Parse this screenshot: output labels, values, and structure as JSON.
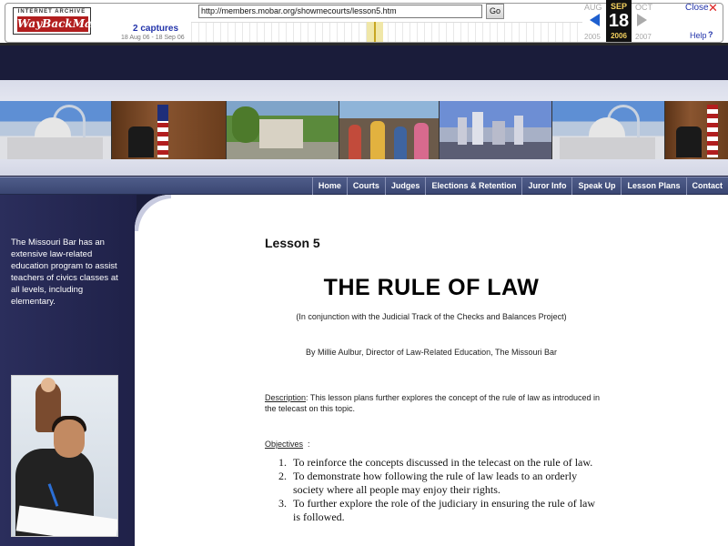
{
  "wayback": {
    "logo_top": "INTERNET ARCHIVE",
    "logo_main": "WayBackMachine",
    "url": "http://members.mobar.org/showmecourts/lesson5.htm",
    "go_label": "Go",
    "captures": "2 captures",
    "capture_range": "18 Aug 06 - 18 Sep 06",
    "month_prev": "AUG",
    "month_current": "SEP",
    "month_next": "OCT",
    "day": "18",
    "year_prev": "2005",
    "year_current": "2006",
    "year_next": "2007",
    "close_label": "Close",
    "help_label": "Help",
    "colors": {
      "accent": "#1e5fcf",
      "highlight": "#f6d35f",
      "close": "#dd2222"
    }
  },
  "nav": {
    "items": [
      "Home",
      "Courts",
      "Judges",
      "Elections & Retention",
      "Juror Info",
      "Speak Up",
      "Lesson Plans",
      "Contact"
    ]
  },
  "sidebar": {
    "text": "The Missouri Bar has an extensive law-related education program to assist teachers of civics classes at all levels, including elementary."
  },
  "lesson": {
    "number": "Lesson 5",
    "title": "THE RULE OF LAW",
    "subtitle": "(In conjunction with the Judicial Track of the Checks and Balances Project)",
    "author": "By Millie Aulbur, Director of Law-Related Education, The Missouri Bar",
    "description_label": "Description",
    "description_text": ":  This lesson plans further explores the concept of the rule of law as introduced in the telecast on this topic.",
    "objectives_label": "Objectives",
    "objectives_colon": ":",
    "objectives": [
      {
        "n": "1.",
        "text": "To reinforce the concepts discussed in the telecast on the rule of law."
      },
      {
        "n": "2.",
        "text": "To demonstrate how following the rule of law leads to an orderly society where all people may enjoy their rights."
      },
      {
        "n": "3.",
        "text": "To further explore the role of the judiciary in ensuring the rule of law is followed."
      }
    ]
  }
}
